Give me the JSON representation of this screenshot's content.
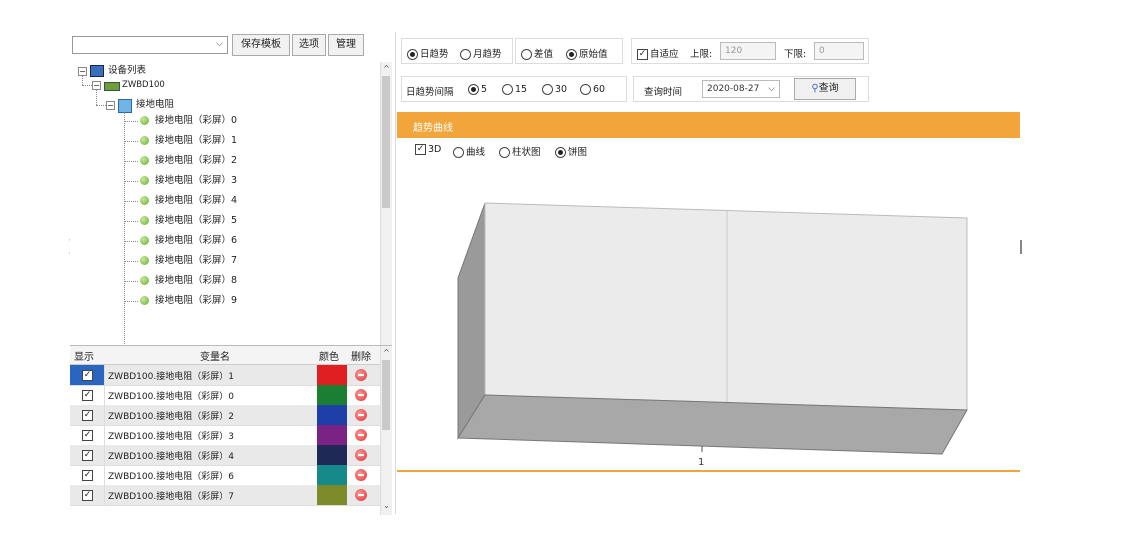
{
  "toolbar": {
    "combo_value": "",
    "save_template": "保存模板",
    "options": "选项",
    "manage": "管理"
  },
  "tree": {
    "root": "设备列表",
    "device": "ZWBD100",
    "group": "接地电阻",
    "items": [
      "接地电阻（彩屏）0",
      "接地电阻（彩屏）1",
      "接地电阻（彩屏）2",
      "接地电阻（彩屏）3",
      "接地电阻（彩屏）4",
      "接地电阻（彩屏）5",
      "接地电阻（彩屏）6",
      "接地电阻（彩屏）7",
      "接地电阻（彩屏）8",
      "接地电阻（彩屏）9"
    ]
  },
  "grid": {
    "headers": {
      "show": "显示",
      "name": "变量名",
      "color": "颜色",
      "delete": "删除"
    },
    "rows": [
      {
        "name": "ZWBD100.接地电阻（彩屏）1",
        "color": "#e02020",
        "selected": true
      },
      {
        "name": "ZWBD100.接地电阻（彩屏）0",
        "color": "#1a7f32",
        "selected": false
      },
      {
        "name": "ZWBD100.接地电阻（彩屏）2",
        "color": "#1f3fa8",
        "selected": false
      },
      {
        "name": "ZWBD100.接地电阻（彩屏）3",
        "color": "#7a2385",
        "selected": false
      },
      {
        "name": "ZWBD100.接地电阻（彩屏）4",
        "color": "#1e2a55",
        "selected": false
      },
      {
        "name": "ZWBD100.接地电阻（彩屏）6",
        "color": "#168a8a",
        "selected": false
      },
      {
        "name": "ZWBD100.接地电阻（彩屏）7",
        "color": "#7d8a2a",
        "selected": false
      }
    ]
  },
  "trend": {
    "day": "日趋势",
    "month": "月趋势",
    "diff": "差值",
    "raw": "原始值",
    "auto": "自适应",
    "upper_label": "上限:",
    "upper_value": "120",
    "lower_label": "下限:",
    "lower_value": "0",
    "interval_label": "日趋势间隔",
    "intervals": [
      "5",
      "15",
      "30",
      "60"
    ],
    "query_time_label": "查询时间",
    "query_date": "2020-08-27",
    "query_button": "查询"
  },
  "panel": {
    "title": "趋势曲线",
    "opt_3d": "3D",
    "opt_curve": "曲线",
    "opt_bar": "柱状图",
    "opt_pie": "饼图"
  },
  "chart_data": {
    "type": "bar",
    "categories": [
      "1"
    ],
    "values": [],
    "title": "",
    "xlabel": "",
    "ylabel": ""
  }
}
